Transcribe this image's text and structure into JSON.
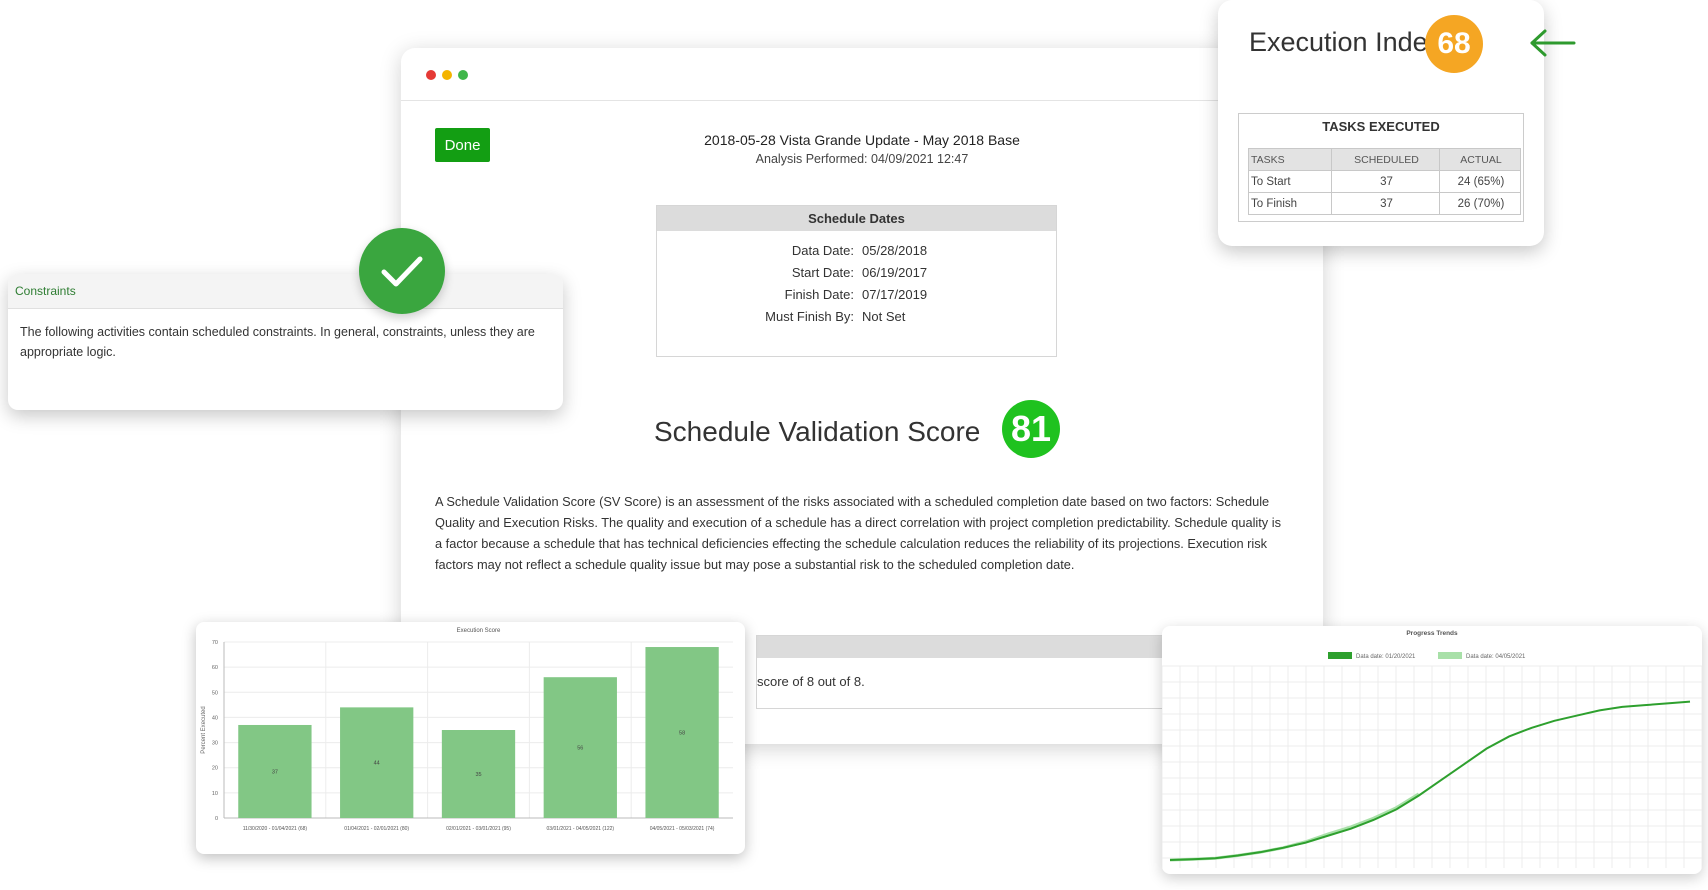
{
  "main": {
    "done_label": "Done",
    "title": "2018-05-28 Vista Grande Update - May 2018 Base",
    "analysis": "Analysis Performed: 04/09/2021 12:47",
    "schedule_dates": {
      "heading": "Schedule Dates",
      "rows": [
        {
          "label": "Data Date:",
          "value": "05/28/2018"
        },
        {
          "label": "Start Date:",
          "value": "06/19/2017"
        },
        {
          "label": "Finish Date:",
          "value": "07/17/2019"
        },
        {
          "label": "Must Finish By:",
          "value": "Not Set"
        }
      ]
    },
    "sv_title": "Schedule Validation Score",
    "sv_score": "81",
    "sv_description": "A Schedule Validation Score (SV Score) is an assessment of the risks associated with a scheduled completion date based on two factors: Schedule Quality and Execution Risks. The quality and execution of a schedule has a direct correlation with project completion predictability. Schedule quality is a factor because a schedule that has technical deficiencies effecting the schedule calculation reduces the reliability of its projections. Execution risk factors may not reflect a schedule quality issue but may pose a substantial risk to the scheduled completion date.",
    "strip_text": "score of 8 out of 8."
  },
  "constraints": {
    "heading": "Constraints",
    "body": "The following activities contain scheduled constraints.  In general, constraints, unless they are appropriate logic."
  },
  "execution_index": {
    "title": "Execution Index",
    "score": "68",
    "tasks_title": "TASKS EXECUTED",
    "headers": [
      "TASKS",
      "SCHEDULED",
      "ACTUAL"
    ],
    "rows": [
      {
        "task": "To Start",
        "scheduled": "37",
        "actual": "24 (65%)"
      },
      {
        "task": "To Finish",
        "scheduled": "37",
        "actual": "26 (70%)"
      }
    ]
  },
  "colors": {
    "green": "#1fc21f",
    "orange": "#f5a623",
    "done_green": "#139e13",
    "bar_green": "#82c785",
    "line_dark": "#2ea02e",
    "line_light": "#a8e0a8"
  },
  "chart_data": [
    {
      "type": "bar",
      "title": "Execution Score",
      "ylabel": "Percent Executed",
      "xlabel": "",
      "ylim": [
        0,
        70
      ],
      "yticks": [
        0,
        10,
        20,
        30,
        40,
        50,
        60,
        70
      ],
      "categories": [
        "11/30/2020 - 01/04/2021 (68)",
        "01/04/2021 - 02/01/2021 (80)",
        "02/01/2021 - 03/01/2021 (95)",
        "03/01/2021 - 04/05/2021 (122)",
        "04/05/2021 - 05/03/2021 (74)"
      ],
      "values": [
        37,
        44,
        35,
        56,
        68
      ],
      "data_labels": [
        "37",
        "44",
        "35",
        "56",
        "58"
      ]
    },
    {
      "type": "line",
      "title": "Progress Trends",
      "grid": true,
      "legend_position": "top",
      "series": [
        {
          "name": "Data date: 01/20/2021",
          "values": [
            0,
            0.4,
            1,
            2.6,
            4.5,
            7,
            10,
            14,
            18,
            23,
            29,
            37,
            46,
            55,
            64,
            71,
            76,
            80,
            83,
            86,
            88,
            89,
            90,
            91
          ]
        },
        {
          "name": "Data date: 04/05/2021",
          "values": [
            0,
            0.4,
            1,
            2.6,
            4.5,
            7,
            10.5,
            15,
            19,
            24,
            30,
            38
          ]
        }
      ],
      "ylim": [
        0,
        100
      ]
    }
  ]
}
